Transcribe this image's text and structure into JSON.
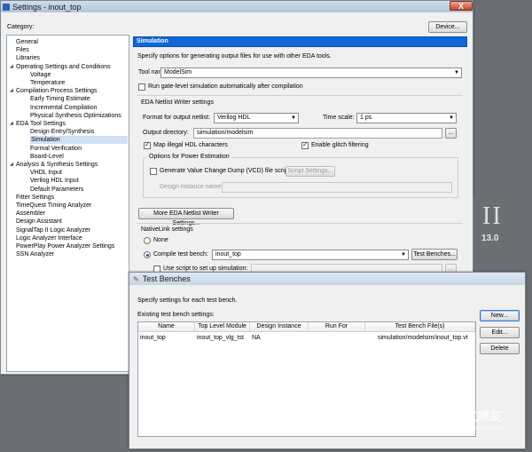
{
  "settings_window": {
    "title": "Settings - inout_top",
    "close_glyph": "X",
    "category_label": "Category:",
    "device_button": "Device...",
    "tree": [
      {
        "label": "General",
        "level": 0,
        "expander": ""
      },
      {
        "label": "Files",
        "level": 0,
        "expander": ""
      },
      {
        "label": "Libraries",
        "level": 0,
        "expander": ""
      },
      {
        "label": "Operating Settings and Conditions",
        "level": 0,
        "expander": "◢"
      },
      {
        "label": "Voltage",
        "level": 1,
        "expander": ""
      },
      {
        "label": "Temperature",
        "level": 1,
        "expander": ""
      },
      {
        "label": "Compilation Process Settings",
        "level": 0,
        "expander": "◢"
      },
      {
        "label": "Early Timing Estimate",
        "level": 1,
        "expander": ""
      },
      {
        "label": "Incremental Compilation",
        "level": 1,
        "expander": ""
      },
      {
        "label": "Physical Synthesis Optimizations",
        "level": 1,
        "expander": ""
      },
      {
        "label": "EDA Tool Settings",
        "level": 0,
        "expander": "◢"
      },
      {
        "label": "Design Entry/Synthesis",
        "level": 1,
        "expander": ""
      },
      {
        "label": "Simulation",
        "level": 1,
        "expander": "",
        "selected": true
      },
      {
        "label": "Formal Verification",
        "level": 1,
        "expander": ""
      },
      {
        "label": "Board-Level",
        "level": 1,
        "expander": ""
      },
      {
        "label": "Analysis & Synthesis Settings",
        "level": 0,
        "expander": "◢"
      },
      {
        "label": "VHDL Input",
        "level": 1,
        "expander": ""
      },
      {
        "label": "Verilog HDL Input",
        "level": 1,
        "expander": ""
      },
      {
        "label": "Default Parameters",
        "level": 1,
        "expander": ""
      },
      {
        "label": "Fitter Settings",
        "level": 0,
        "expander": ""
      },
      {
        "label": "TimeQuest Timing Analyzer",
        "level": 0,
        "expander": ""
      },
      {
        "label": "Assembler",
        "level": 0,
        "expander": ""
      },
      {
        "label": "Design Assistant",
        "level": 0,
        "expander": ""
      },
      {
        "label": "SignalTap II Logic Analyzer",
        "level": 0,
        "expander": ""
      },
      {
        "label": "Logic Analyzer Interface",
        "level": 0,
        "expander": ""
      },
      {
        "label": "PowerPlay Power Analyzer Settings",
        "level": 0,
        "expander": ""
      },
      {
        "label": "SSN Analyzer",
        "level": 0,
        "expander": ""
      }
    ],
    "panel": {
      "header": "Simulation",
      "description": "Specify options for generating output files for use with other EDA tools.",
      "tool_name_label": "Tool name:",
      "tool_name_value": "ModelSim",
      "run_gate_level_label": "Run gate-level simulation automatically after compilation",
      "netlist_group_title": "EDA Netlist Writer settings",
      "format_label": "Format for output netlist:",
      "format_value": "Verilog HDL",
      "time_scale_label": "Time scale:",
      "time_scale_value": "1 ps",
      "output_dir_label": "Output directory:",
      "output_dir_value": "simulation/modelsim",
      "browse_glyph": "...",
      "map_illegal_label": "Map illegal HDL characters",
      "map_illegal_check": "✓",
      "glitch_label": "Enable glitch filtering",
      "glitch_check": "✓",
      "power_group_title": "Options for Power Estimation",
      "vcd_label": "Generate Value Change Dump (VCD) file script",
      "script_settings_button": "Script Settings...",
      "design_instance_label": "Design instance name:",
      "more_eda_button": "More EDA Netlist Writer Settings...",
      "nativelink_title": "NativeLink settings",
      "none_label": "None",
      "compile_tb_label": "Compile test bench:",
      "compile_tb_value": "inout_top",
      "test_benches_button": "Test Benches...",
      "use_script_label": "Use script to set up simulation:"
    },
    "bg_text": {
      "logo": "II",
      "version": "13.0"
    }
  },
  "test_benches_dialog": {
    "title": "Test Benches",
    "description": "Specify settings for each test bench.",
    "existing_label": "Existing test bench settings:",
    "columns": [
      "Name",
      "Top Level Module",
      "Design Instance",
      "Run For",
      "Test Bench File(s)"
    ],
    "rows": [
      {
        "name": "inout_top",
        "top_level_module": "inout_top_vlg_tst",
        "design_instance": "NA",
        "run_for": "",
        "files": "simulation/modelsim/inout_top.vt"
      }
    ],
    "new_button": "New...",
    "edit_button": "Edit...",
    "delete_button": "Delete"
  },
  "watermark": {
    "text": "电子发烧友",
    "url": "www.elecfans.com"
  },
  "colors": {
    "selection": "#cfe0f5",
    "header_blue": "#0f67d8",
    "panel_bg": "#f0f0f0"
  }
}
